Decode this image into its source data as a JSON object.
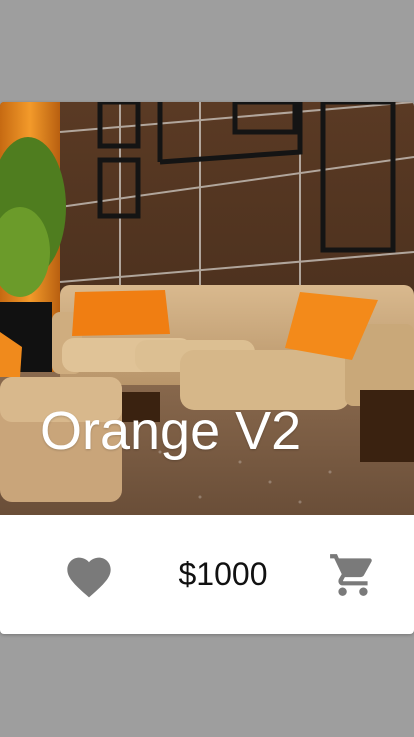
{
  "product": {
    "title": "Orange V2",
    "price": "$1000"
  },
  "icons": {
    "favorite": "heart-icon",
    "cart": "shopping-cart-icon"
  },
  "colors": {
    "background": "#9e9e9e",
    "card": "#ffffff",
    "icon": "#7a7a7a",
    "price_text": "#111111",
    "title_text": "#ffffff",
    "accent_orange": "#f08a1c"
  }
}
